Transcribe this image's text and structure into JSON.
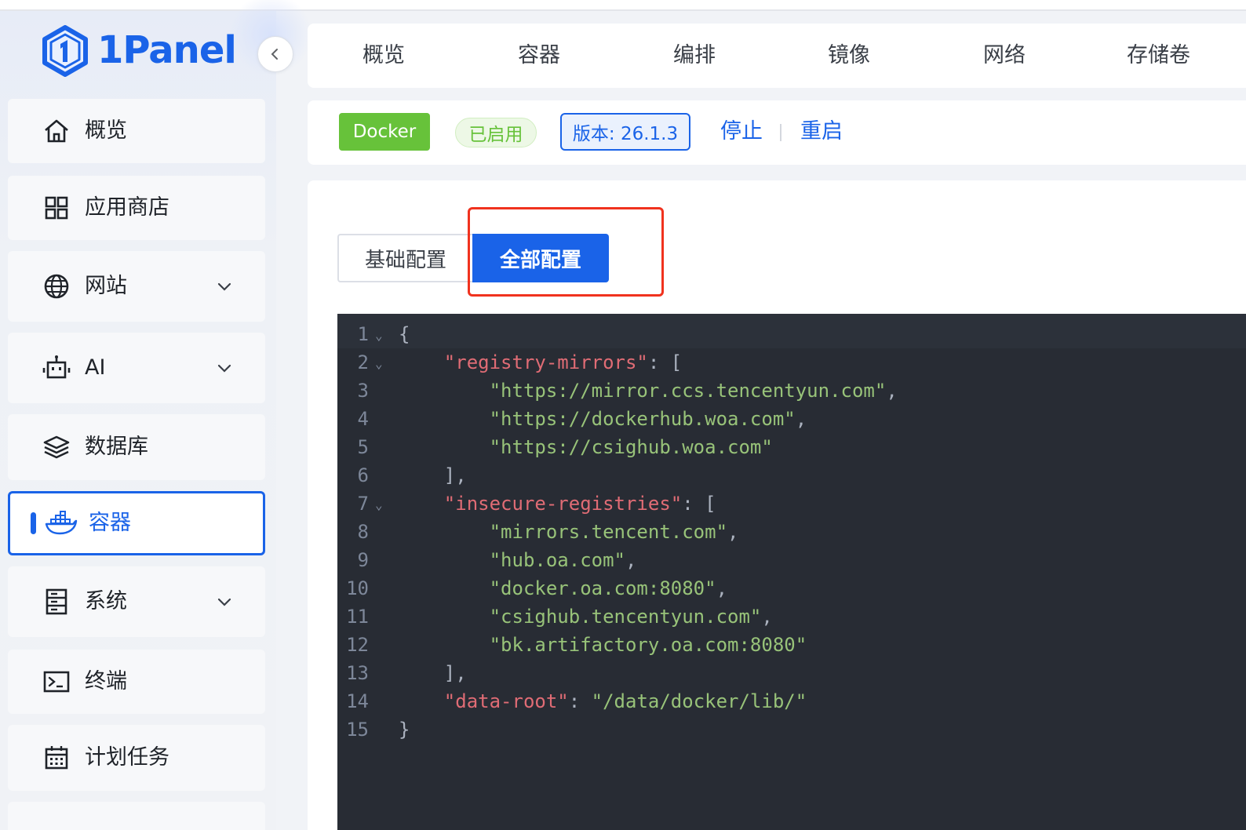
{
  "app": {
    "name": "1Panel"
  },
  "sidebar": {
    "items": [
      {
        "label": "概览",
        "icon": "home-icon",
        "expandable": false,
        "active": false
      },
      {
        "label": "应用商店",
        "icon": "grid-icon",
        "expandable": false,
        "active": false
      },
      {
        "label": "网站",
        "icon": "globe-icon",
        "expandable": true,
        "active": false
      },
      {
        "label": "AI",
        "icon": "robot-icon",
        "expandable": true,
        "active": false
      },
      {
        "label": "数据库",
        "icon": "layers-icon",
        "expandable": false,
        "active": false
      },
      {
        "label": "容器",
        "icon": "docker-icon",
        "expandable": false,
        "active": true
      },
      {
        "label": "系统",
        "icon": "server-icon",
        "expandable": true,
        "active": false
      },
      {
        "label": "终端",
        "icon": "terminal-icon",
        "expandable": false,
        "active": false
      },
      {
        "label": "计划任务",
        "icon": "calendar-icon",
        "expandable": false,
        "active": false
      }
    ]
  },
  "top_tabs": [
    "概览",
    "容器",
    "编排",
    "镜像",
    "网络",
    "存储卷"
  ],
  "status": {
    "service_tag": "Docker",
    "state_tag": "已启用",
    "version_tag": "版本: 26.1.3",
    "stop_label": "停止",
    "restart_label": "重启"
  },
  "config_tabs": {
    "basic": "基础配置",
    "all": "全部配置",
    "selected": "all"
  },
  "editor": {
    "lines": [
      {
        "n": "1",
        "fold": true,
        "tokens": [
          {
            "t": "p",
            "v": "{"
          }
        ]
      },
      {
        "n": "2",
        "fold": true,
        "tokens": [
          {
            "t": "p",
            "v": "    "
          },
          {
            "t": "k",
            "v": "\"registry-mirrors\""
          },
          {
            "t": "p",
            "v": ": ["
          }
        ]
      },
      {
        "n": "3",
        "fold": false,
        "tokens": [
          {
            "t": "p",
            "v": "        "
          },
          {
            "t": "s",
            "v": "\"https://mirror.ccs.tencentyun.com\""
          },
          {
            "t": "p",
            "v": ","
          }
        ]
      },
      {
        "n": "4",
        "fold": false,
        "tokens": [
          {
            "t": "p",
            "v": "        "
          },
          {
            "t": "s",
            "v": "\"https://dockerhub.woa.com\""
          },
          {
            "t": "p",
            "v": ","
          }
        ]
      },
      {
        "n": "5",
        "fold": false,
        "tokens": [
          {
            "t": "p",
            "v": "        "
          },
          {
            "t": "s",
            "v": "\"https://csighub.woa.com\""
          }
        ]
      },
      {
        "n": "6",
        "fold": false,
        "tokens": [
          {
            "t": "p",
            "v": "    ],"
          }
        ]
      },
      {
        "n": "7",
        "fold": true,
        "tokens": [
          {
            "t": "p",
            "v": "    "
          },
          {
            "t": "k",
            "v": "\"insecure-registries\""
          },
          {
            "t": "p",
            "v": ": ["
          }
        ]
      },
      {
        "n": "8",
        "fold": false,
        "tokens": [
          {
            "t": "p",
            "v": "        "
          },
          {
            "t": "s",
            "v": "\"mirrors.tencent.com\""
          },
          {
            "t": "p",
            "v": ","
          }
        ]
      },
      {
        "n": "9",
        "fold": false,
        "tokens": [
          {
            "t": "p",
            "v": "        "
          },
          {
            "t": "s",
            "v": "\"hub.oa.com\""
          },
          {
            "t": "p",
            "v": ","
          }
        ]
      },
      {
        "n": "10",
        "fold": false,
        "tokens": [
          {
            "t": "p",
            "v": "        "
          },
          {
            "t": "s",
            "v": "\"docker.oa.com:8080\""
          },
          {
            "t": "p",
            "v": ","
          }
        ]
      },
      {
        "n": "11",
        "fold": false,
        "tokens": [
          {
            "t": "p",
            "v": "        "
          },
          {
            "t": "s",
            "v": "\"csighub.tencentyun.com\""
          },
          {
            "t": "p",
            "v": ","
          }
        ]
      },
      {
        "n": "12",
        "fold": false,
        "tokens": [
          {
            "t": "p",
            "v": "        "
          },
          {
            "t": "s",
            "v": "\"bk.artifactory.oa.com:8080\""
          }
        ]
      },
      {
        "n": "13",
        "fold": false,
        "tokens": [
          {
            "t": "p",
            "v": "    ],"
          }
        ]
      },
      {
        "n": "14",
        "fold": false,
        "tokens": [
          {
            "t": "p",
            "v": "    "
          },
          {
            "t": "k",
            "v": "\"data-root\""
          },
          {
            "t": "p",
            "v": ": "
          },
          {
            "t": "s",
            "v": "\"/data/docker/lib/\""
          }
        ]
      },
      {
        "n": "15",
        "fold": false,
        "tokens": [
          {
            "t": "p",
            "v": "}"
          }
        ]
      }
    ]
  },
  "colors": {
    "accent": "#1a63e8",
    "success": "#67c23a",
    "highlight": "#f0321e",
    "editor_bg": "#282c34",
    "json_key": "#e06c75",
    "json_string": "#98c379"
  }
}
